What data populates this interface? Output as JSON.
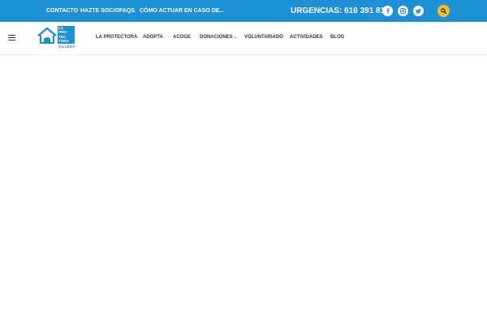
{
  "topbar": {
    "links": [
      "CONTACTO",
      "HAZTE SOCIO",
      "FAQS",
      "CÓMO ACTUAR EN CASO DE..."
    ],
    "urgencias": "URGENCIAS: 616 391 813",
    "social_icons": [
      "facebook-icon",
      "instagram-icon",
      "twitter-icon"
    ],
    "search_icon": "search-icon"
  },
  "logo": {
    "lines": [
      "LA",
      "PRO",
      "TEC",
      "TORA"
    ],
    "subtitle": "VILLENA"
  },
  "nav": {
    "items": [
      "LA PROTECTORA",
      "ADOPTA",
      "ACOGE",
      "DONACIONES",
      "VOLUNTARIADO",
      "ACTIVIDADES",
      "BLOG"
    ]
  },
  "colors": {
    "brand_blue": "#1e90d6",
    "search_yellow": "#f5c31b",
    "nav_text": "#333333"
  }
}
